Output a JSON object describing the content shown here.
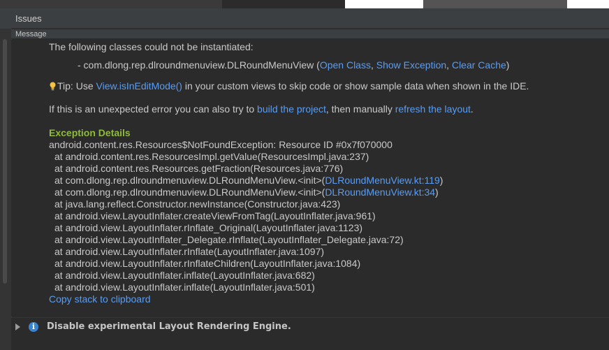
{
  "panel": {
    "title": "Issues",
    "column_header": "Message"
  },
  "message": {
    "intro": "The following classes could not be instantiated:",
    "bullet_prefix": "- com.dlong.rep.dlroundmenuview.DLRoundMenuView (",
    "link_open_class": "Open Class",
    "comma1": ", ",
    "link_show_exception": "Show Exception",
    "comma2": ", ",
    "link_clear_cache": "Clear Cache",
    "close_paren": ")",
    "tip_prefix": "Tip: Use ",
    "tip_link": "View.isInEditMode()",
    "tip_suffix": " in your custom views to skip code or show sample data when shown in the IDE.",
    "unexpected_prefix": "If this is an unexpected error you can also try to ",
    "build_link": "build the project",
    "unexpected_middle": ", then manually ",
    "refresh_link": "refresh the layout",
    "unexpected_suffix": "."
  },
  "exception": {
    "title": "Exception Details",
    "first_line": "android.content.res.Resources$NotFoundException: Resource ID #0x7f070000",
    "frames": [
      {
        "text": "at android.content.res.ResourcesImpl.getValue(ResourcesImpl.java:237)"
      },
      {
        "text": "at android.content.res.Resources.getFraction(Resources.java:776)"
      },
      {
        "text": "at com.dlong.rep.dlroundmenuview.DLRoundMenuView.<init>(",
        "link": "DLRoundMenuView.kt:119",
        "tail": ")"
      },
      {
        "text": "at com.dlong.rep.dlroundmenuview.DLRoundMenuView.<init>(",
        "link": "DLRoundMenuView.kt:34",
        "tail": ")"
      },
      {
        "text": "at java.lang.reflect.Constructor.newInstance(Constructor.java:423)"
      },
      {
        "text": "at android.view.LayoutInflater.createViewFromTag(LayoutInflater.java:961)"
      },
      {
        "text": "at android.view.LayoutInflater.rInflate_Original(LayoutInflater.java:1123)"
      },
      {
        "text": "at android.view.LayoutInflater_Delegate.rInflate(LayoutInflater_Delegate.java:72)"
      },
      {
        "text": "at android.view.LayoutInflater.rInflate(LayoutInflater.java:1097)"
      },
      {
        "text": "at android.view.LayoutInflater.rInflateChildren(LayoutInflater.java:1084)"
      },
      {
        "text": "at android.view.LayoutInflater.inflate(LayoutInflater.java:682)"
      },
      {
        "text": "at android.view.LayoutInflater.inflate(LayoutInflater.java:501)"
      }
    ],
    "copy_link": "Copy stack to clipboard"
  },
  "footer": {
    "info_glyph": "i",
    "label": "Disable experimental Layout Rendering Engine."
  },
  "colors": {
    "link": "#589df6",
    "exception_title": "#8fbb3a",
    "info_badge": "#3b83d1"
  },
  "icons": {
    "tip": "lightbulb-icon",
    "expand": "triangle-right-icon",
    "info": "info-icon"
  }
}
